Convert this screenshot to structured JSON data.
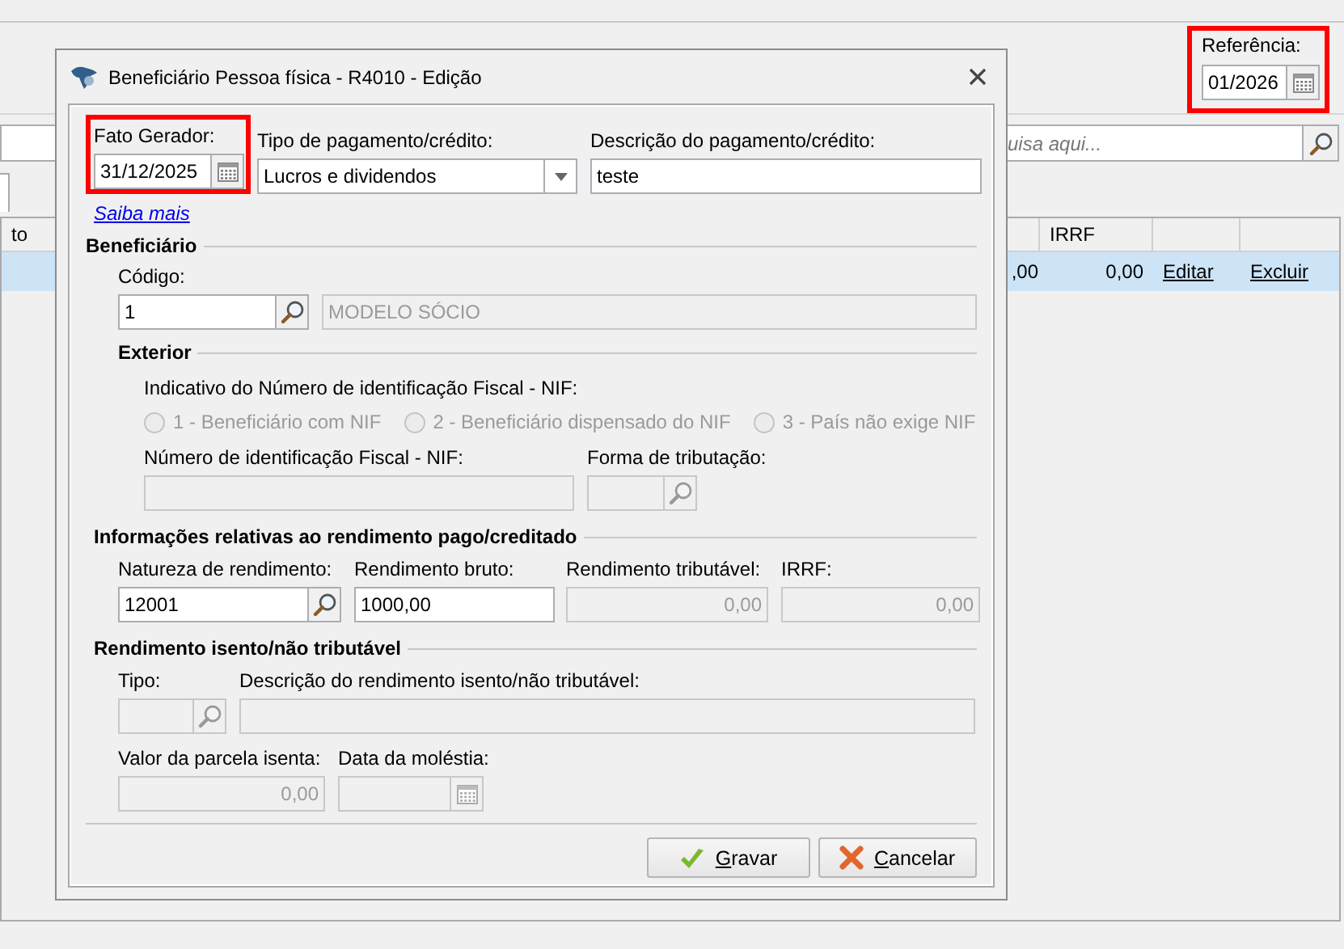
{
  "background": {
    "reference": {
      "label": "Referência:",
      "value": "01/2026",
      "highlighted": true
    },
    "search": {
      "placeholder": "uisa aqui..."
    },
    "table": {
      "columns": [
        "to",
        "IRRF"
      ],
      "rows": [
        {
          "column_2": ",00",
          "irrf": "0,00",
          "edit": "Editar",
          "delete": "Excluir",
          "selected": true
        }
      ]
    }
  },
  "dialog": {
    "title": "Beneficiário Pessoa física - R4010 - Edição",
    "fato_gerador": {
      "label": "Fato Gerador:",
      "value": "31/12/2025",
      "highlighted": true
    },
    "tipo_pagamento": {
      "label": "Tipo de pagamento/crédito:",
      "value": "Lucros e dividendos"
    },
    "descricao": {
      "label": "Descrição do pagamento/crédito:",
      "value": "teste"
    },
    "help_link": "Saiba mais",
    "beneficiario": {
      "title": "Beneficiário",
      "codigo": {
        "label": "Código:",
        "value": "1",
        "disabled": false
      },
      "nome": {
        "value": "MODELO SÓCIO",
        "disabled": true
      }
    },
    "exterior": {
      "title": "Exterior",
      "nif_indicator": {
        "label": "Indicativo do Número de identificação Fiscal - NIF:",
        "options": [
          {
            "label": "1 - Beneficiário com NIF",
            "selected": false,
            "disabled": true
          },
          {
            "label": "2 - Beneficiário dispensado do NIF",
            "selected": false,
            "disabled": true
          },
          {
            "label": "3 - País não exige NIF",
            "selected": false,
            "disabled": true
          }
        ]
      },
      "nif": {
        "label": "Número de identificação Fiscal - NIF:",
        "disabled": true
      },
      "forma_tributacao": {
        "label": "Forma de tributação:",
        "disabled": true
      }
    },
    "rendimento": {
      "title": "Informações relativas ao rendimento pago/creditado",
      "natureza": {
        "label": "Natureza de rendimento:",
        "value": "12001",
        "disabled": false
      },
      "bruto": {
        "label": "Rendimento bruto:",
        "value": "1000,00",
        "disabled": false
      },
      "tributavel": {
        "label": "Rendimento tributável:",
        "value": "0,00",
        "disabled": true
      },
      "irrf": {
        "label": "IRRF:",
        "value": "0,00",
        "disabled": true
      }
    },
    "isento": {
      "title": "Rendimento isento/não tributável",
      "tipo": {
        "label": "Tipo:",
        "disabled": true
      },
      "descricao": {
        "label": "Descrição do rendimento isento/não tributável:",
        "disabled": true
      },
      "valor_parcela": {
        "label": "Valor da parcela isenta:",
        "value": "0,00",
        "disabled": true
      },
      "data_molestia": {
        "label": "Data da moléstia:",
        "disabled": true
      }
    },
    "buttons": [
      {
        "label": "Gravar",
        "kind": "save"
      },
      {
        "label": "Cancelar",
        "kind": "cancel"
      }
    ]
  }
}
